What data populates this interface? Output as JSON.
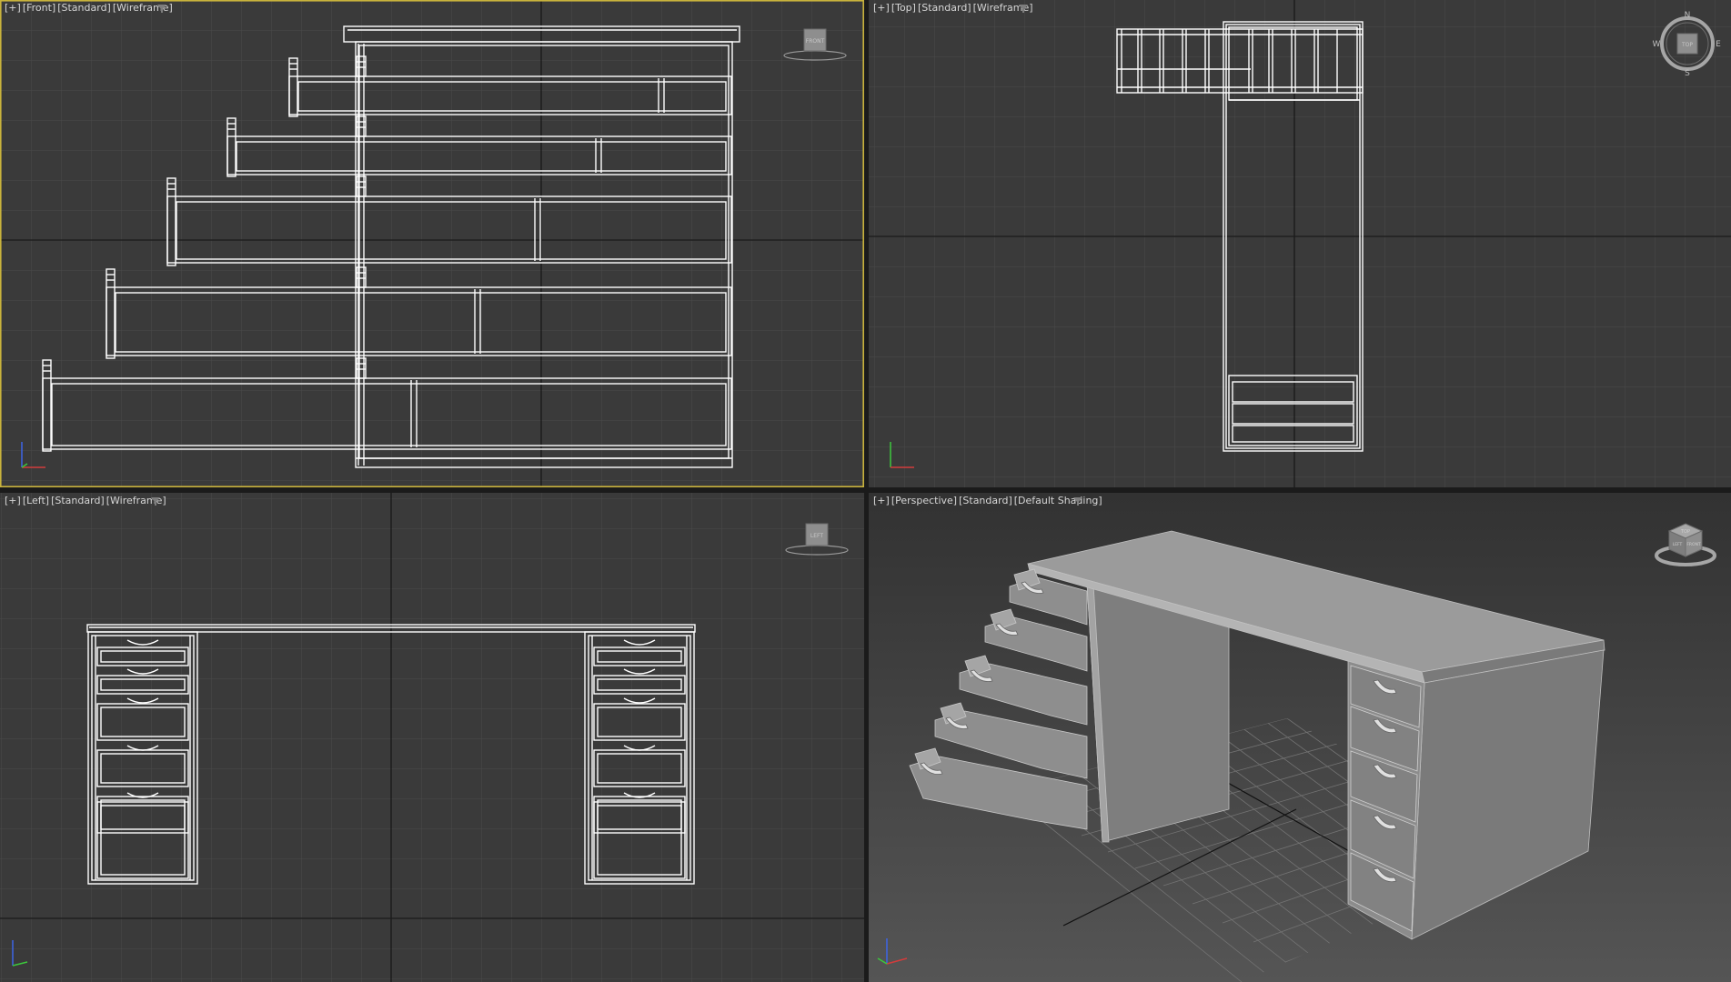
{
  "viewports": {
    "front": {
      "label": {
        "menu": "[+]",
        "view": "[Front]",
        "shading_set": "[Standard]",
        "mode": "[Wireframe]"
      },
      "cube_label": "FRONT",
      "active": true
    },
    "top": {
      "label": {
        "menu": "[+]",
        "view": "[Top]",
        "shading_set": "[Standard]",
        "mode": "[Wireframe]"
      },
      "cube_label": "TOP",
      "compass": {
        "n": "N",
        "s": "S",
        "e": "E",
        "w": "W"
      }
    },
    "left": {
      "label": {
        "menu": "[+]",
        "view": "[Left]",
        "shading_set": "[Standard]",
        "mode": "[Wireframe]"
      },
      "cube_label": "LEFT"
    },
    "perspective": {
      "label": {
        "menu": "[+]",
        "view": "[Perspective]",
        "shading_set": "[Standard]",
        "mode": "[Default Shading]"
      },
      "cube_faces": {
        "top": "TOP",
        "front": "FRONT",
        "left": "LEFT"
      }
    }
  },
  "colors": {
    "active_border": "#c9b33c",
    "wire": "#ffffff",
    "grid": "#4b4b4b",
    "axis_x": "#d23c3c",
    "axis_y": "#3cc83c",
    "axis_z": "#3c64e6"
  }
}
